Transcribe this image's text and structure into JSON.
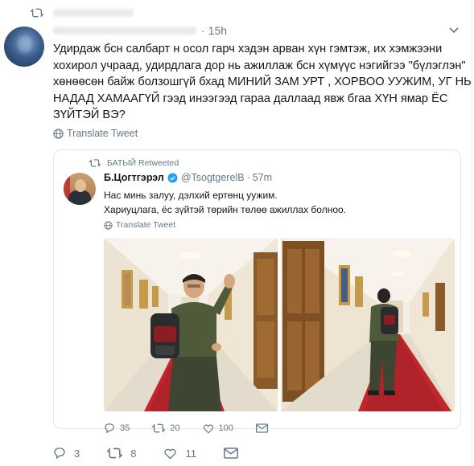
{
  "retweet_header": {
    "icon": "retweet-icon",
    "text": ""
  },
  "tweet": {
    "timestamp": "15h",
    "separator": "·",
    "text_lines": [
      "Удирдаж бсн салбарт н осол гарч хэдэн арван хүн гэмтэж, их хэмжээни",
      "хохирол учраад, удирдлага дор нь ажиллаж бсн хүмүүс нэгийгээ \"бүлэглэн\"",
      "хөнөөсөн байж болзошгүй бхад МИНИЙ ЗАМ УРТ , ХОРВОО УУЖИМ, УГ НЬ",
      "НАДАД ХАМААГҮЙ гээд инээгээд гараа даллаад явж бгаа ХҮН ямар ЁС",
      "ЗҮЙТЭЙ ВЭ?"
    ],
    "translate_label": "Translate Tweet",
    "actions": {
      "replies": "3",
      "retweets": "8",
      "likes": "11"
    }
  },
  "quoted": {
    "retweeted_by": "БАТЫЙ Retweeted",
    "name": "Б.Цогтгэрэл",
    "handle": "@TsogtgerelB",
    "separator": "·",
    "time": "57m",
    "text_lines": [
      "Нас минь залуу, дэлхий ертөнц уужим.",
      "Хариуцлага, ёс зүйтэй төрийн төлөө ажиллах болноо."
    ],
    "translate_label": "Translate Tweet",
    "actions": {
      "replies": "35",
      "retweets": "20",
      "likes": "100"
    }
  },
  "colors": {
    "text": "#14171a",
    "muted": "#657786",
    "border": "#e1e8ed",
    "verified": "#1da1f2",
    "carpet": "#c1272d"
  }
}
